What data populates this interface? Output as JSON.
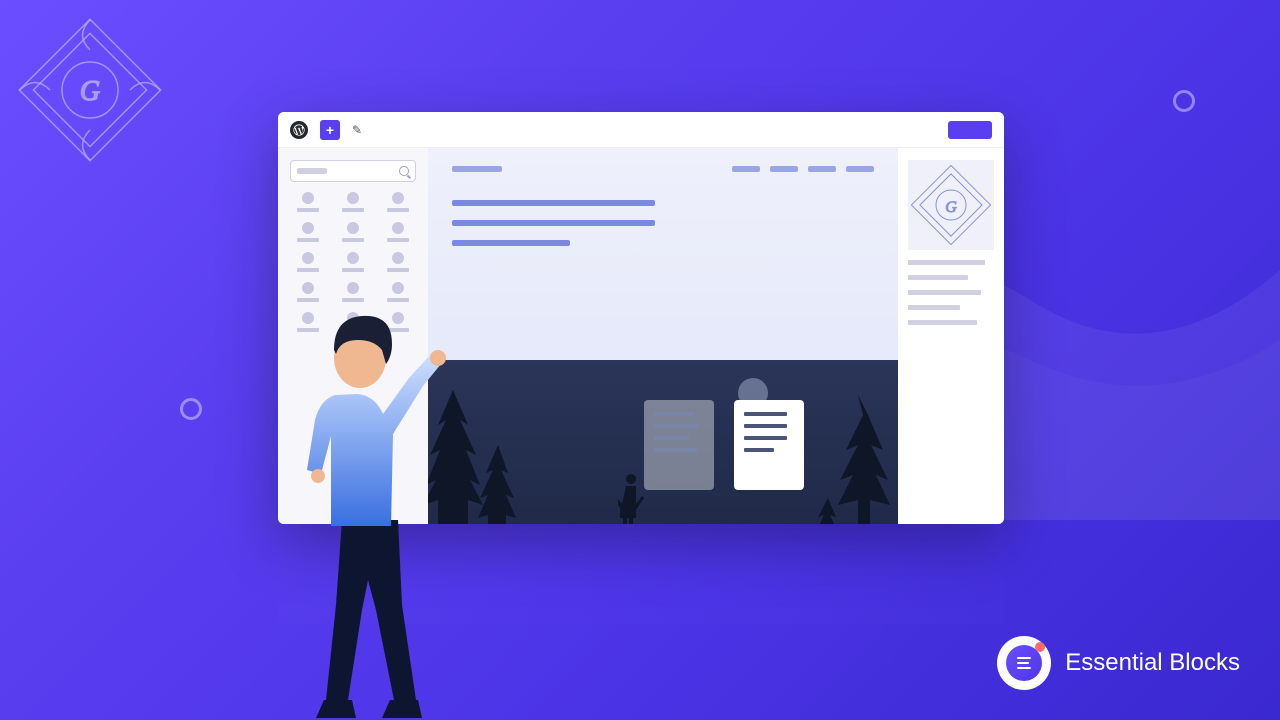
{
  "brand": {
    "name": "Essential Blocks"
  },
  "topbar": {
    "add_label": "+"
  },
  "colors": {
    "primary": "#5a3ff0",
    "bg_gradient_start": "#6b4eff",
    "bg_gradient_end": "#3a28d0"
  },
  "sidebar_left": {
    "block_count": 15
  },
  "sidebar_right": {
    "line_count": 5
  }
}
